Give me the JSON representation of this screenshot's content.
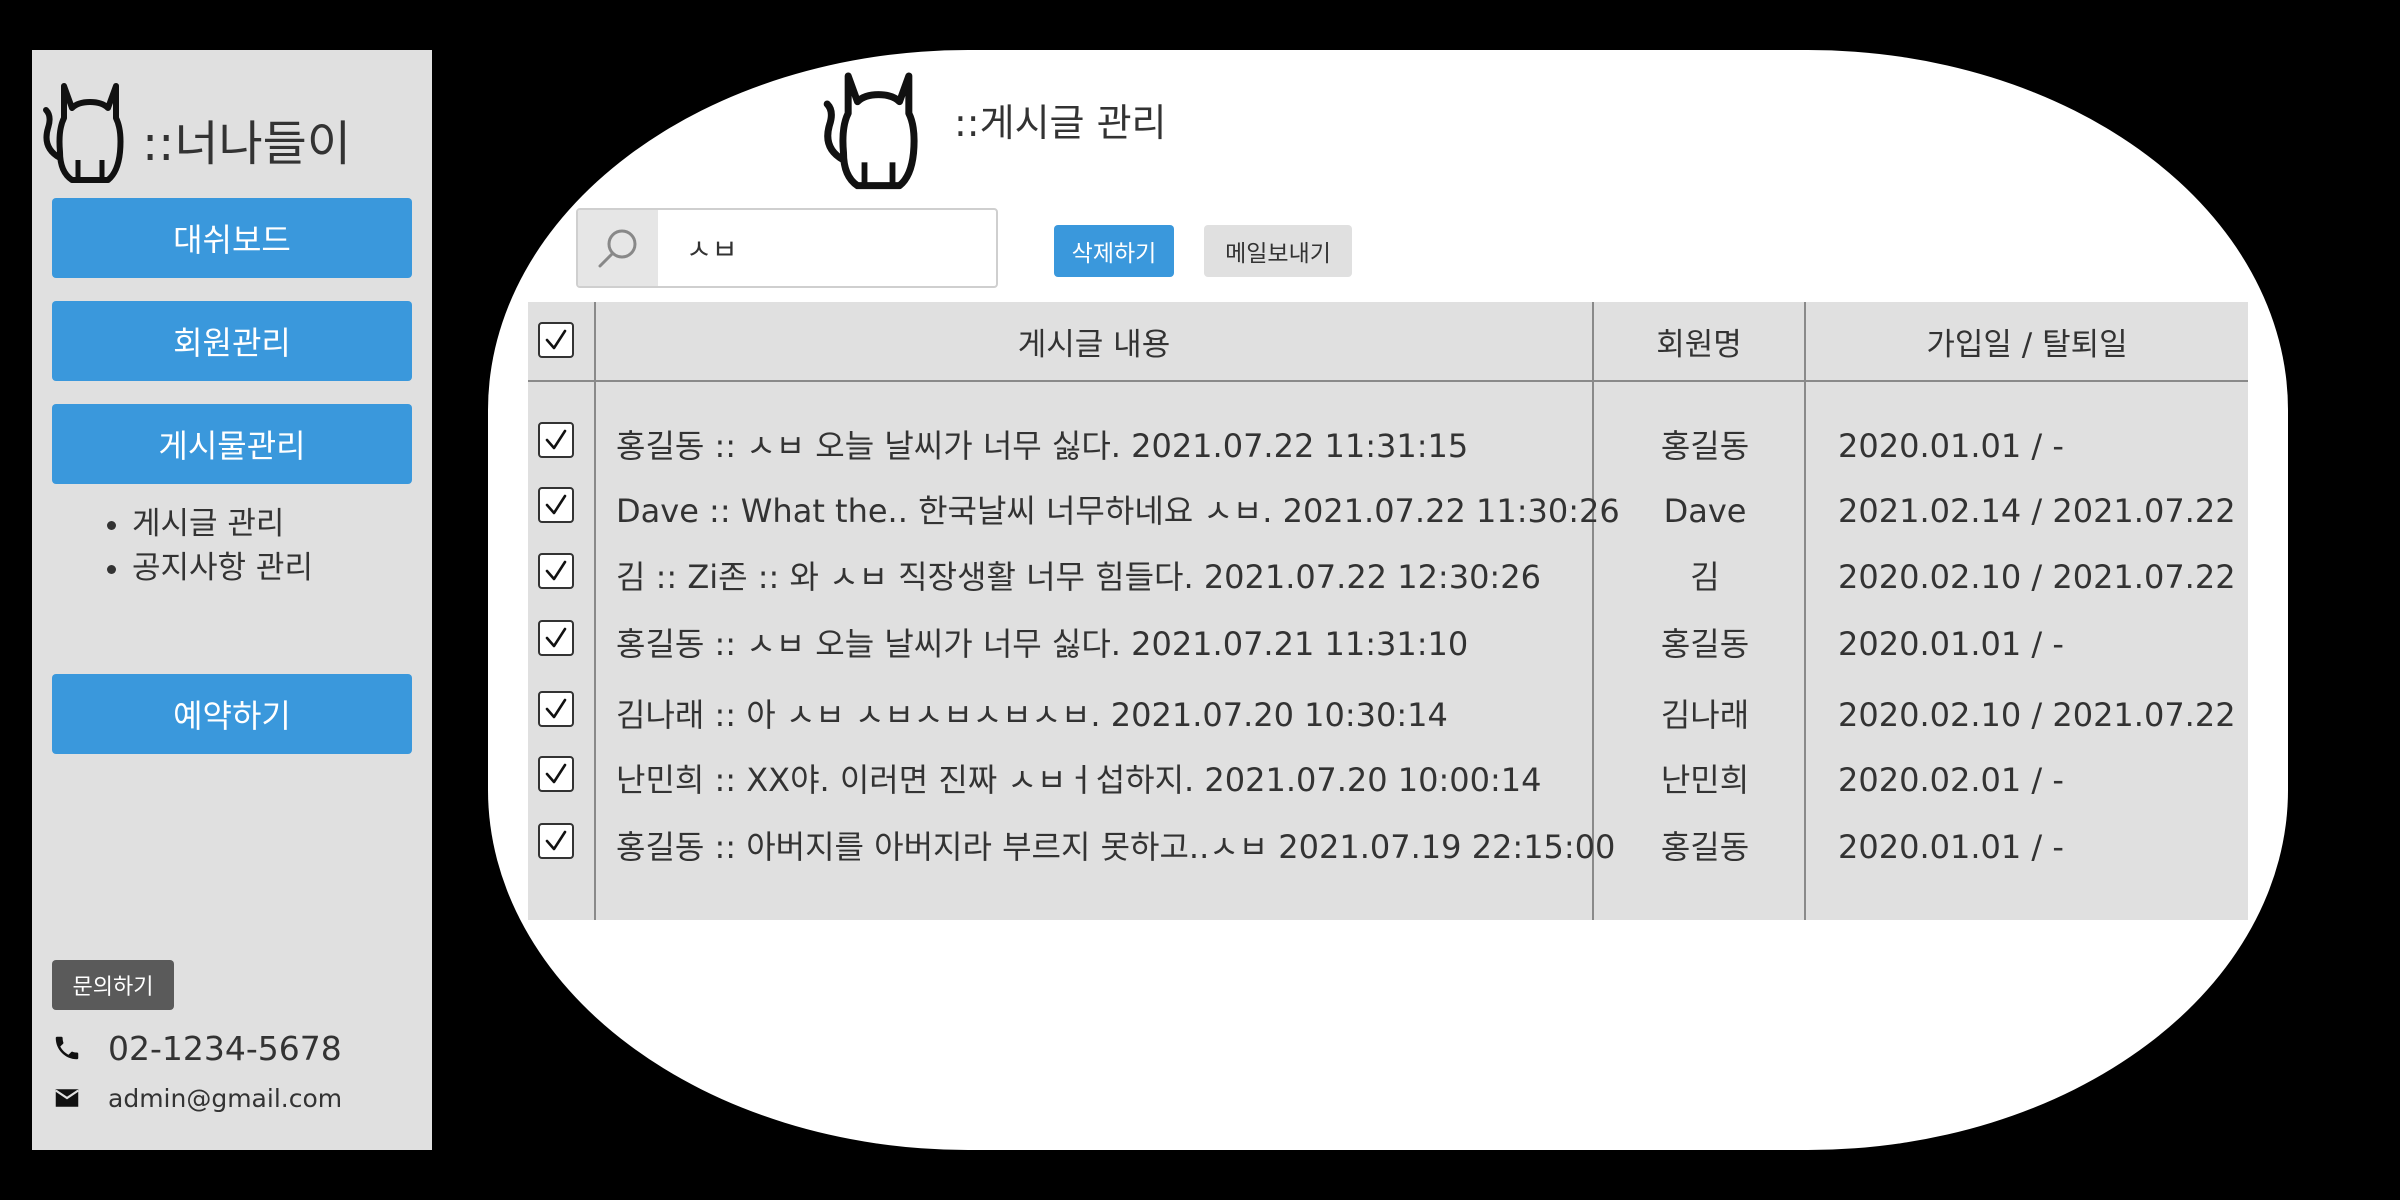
{
  "sidebar": {
    "brand": "::너나들이",
    "nav": [
      "대쉬보드",
      "회원관리",
      "게시물관리"
    ],
    "submenu": [
      "게시글 관리",
      "공지사항 관리"
    ],
    "reserve": "예약하기",
    "inquiry": "문의하기",
    "phone": "02-1234-5678",
    "email": "admin@gmail.com"
  },
  "main": {
    "title": "::게시글 관리",
    "search_value": "ㅅㅂ",
    "delete_label": "삭제하기",
    "mail_label": "메일보내기",
    "columns": [
      "게시글 내용",
      "회원명",
      "가입일 / 탈퇴일"
    ],
    "rows": [
      {
        "content": "홍길동 :: ㅅㅂ 오늘 날씨가 너무 싫다. 2021.07.22 11:31:15",
        "name": "홍길동",
        "dates": "2020.01.01 / -"
      },
      {
        "content": "Dave :: What the.. 한국날씨 너무하네요 ㅅㅂ. 2021.07.22 11:30:26",
        "name": "Dave",
        "dates": "2021.02.14 / 2021.07.22"
      },
      {
        "content": "김 :: Zi존 :: 와 ㅅㅂ 직장생활 너무 힘들다. 2021.07.22 12:30:26",
        "name": "김",
        "dates": "2020.02.10 / 2021.07.22"
      },
      {
        "content": "홍길동 :: ㅅㅂ 오늘 날씨가 너무 싫다. 2021.07.21 11:31:10",
        "name": "홍길동",
        "dates": "2020.01.01 / -"
      },
      {
        "content": "김나래 :: 아 ㅅㅂ ㅅㅂㅅㅂㅅㅂㅅㅂ. 2021.07.20 10:30:14",
        "name": "김나래",
        "dates": "2020.02.10 / 2021.07.22"
      },
      {
        "content": "난민희 :: XX야. 이러면 진짜 ㅅㅂㅓ섭하지. 2021.07.20 10:00:14",
        "name": "난민희",
        "dates": "2020.02.01 / -"
      },
      {
        "content": "홍길동 :: 아버지를 아버지라 부르지 못하고..ㅅㅂ 2021.07.19 22:15:00",
        "name": "홍길동",
        "dates": "2020.01.01 / -"
      }
    ]
  },
  "colors": {
    "accent": "#3a98dc",
    "sidebar_bg": "#e0e0e0",
    "table_bg": "#e0e0e0",
    "inquiry_bg": "#5a5a5a"
  },
  "icons": [
    "cat-logo-icon",
    "search-icon",
    "checkbox-checked-icon",
    "phone-icon",
    "mail-icon"
  ]
}
